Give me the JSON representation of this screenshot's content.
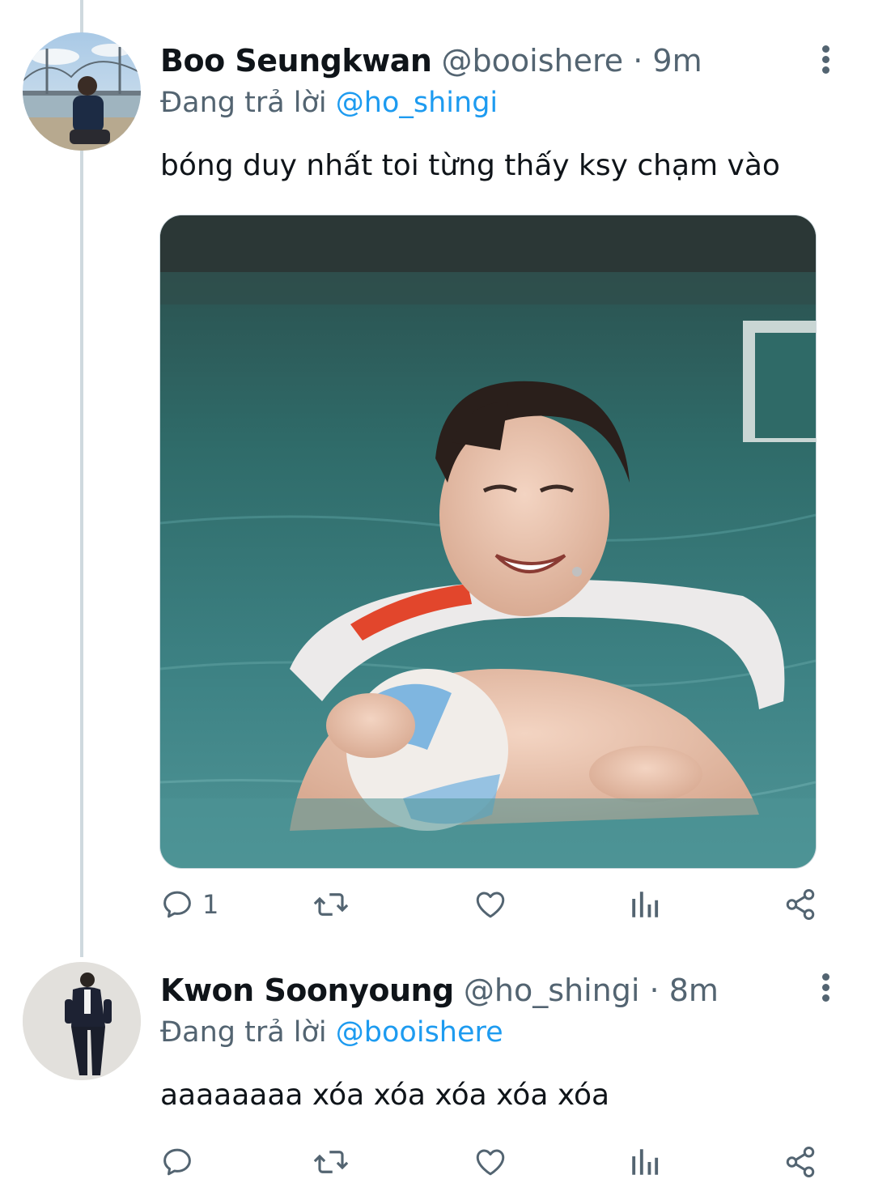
{
  "tweets": [
    {
      "name": "Boo Seungkwan",
      "handle": "@booishere",
      "sep": "·",
      "time": "9m",
      "reply_prefix": "Đang trả lời",
      "reply_mention": "@ho_shingi",
      "text": "bóng duy nhất toi từng thấy ksy chạm vào",
      "reply_count": "1"
    },
    {
      "name": "Kwon Soonyoung",
      "handle": "@ho_shingi",
      "sep": "·",
      "time": "8m",
      "reply_prefix": "Đang trả lời",
      "reply_mention": "@booishere",
      "text": "aaaaaaaa xóa xóa xóa xóa xóa",
      "reply_count": ""
    }
  ],
  "icons": {
    "reply": "reply-icon",
    "retweet": "retweet-icon",
    "like": "heart-icon",
    "views": "bar-chart-icon",
    "share": "share-icon",
    "more": "more-vertical-icon"
  },
  "colors": {
    "text": "#0f1419",
    "secondary": "#536471",
    "link": "#1d9bf0",
    "thread_line": "#cfd9de"
  }
}
